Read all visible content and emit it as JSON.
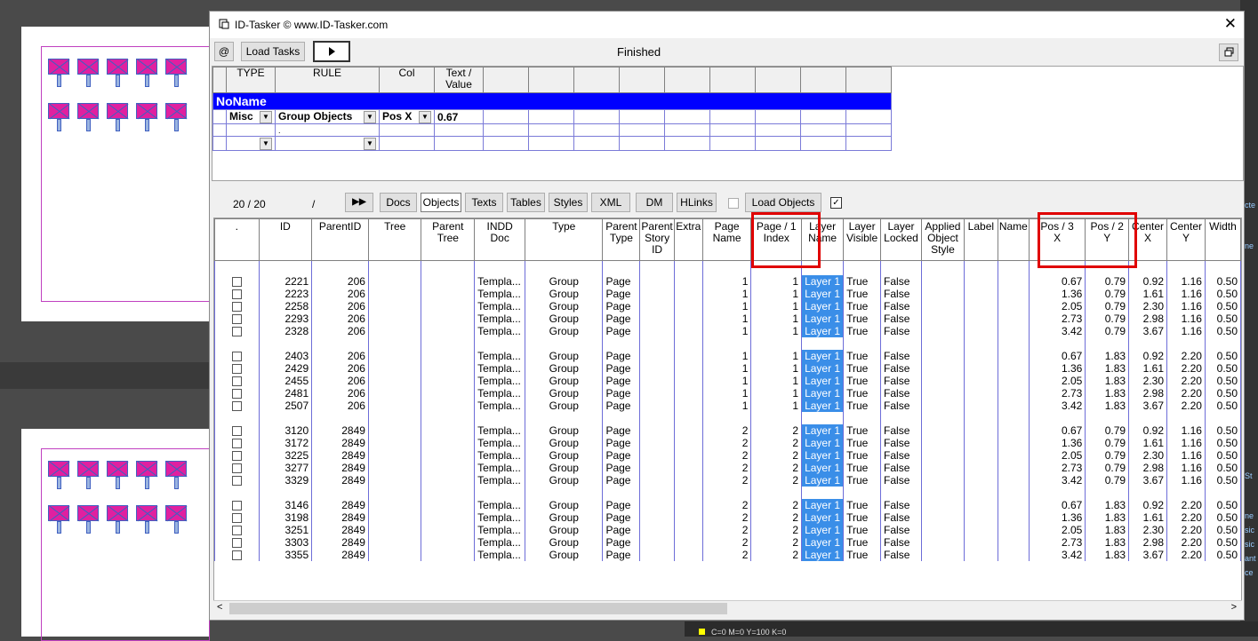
{
  "window": {
    "title": "ID-Tasker  © www.ID-Tasker.com",
    "close_icon": "✕"
  },
  "toolbar": {
    "at_label": "@",
    "load_tasks_label": "Load Tasks",
    "run_icon": "play-icon",
    "status": "Finished",
    "restore_icon": "restore-icon"
  },
  "rules": {
    "headers": [
      "TYPE",
      "RULE",
      "Col",
      "Text / Value"
    ],
    "group_name": "NoName",
    "row": {
      "type": "Misc",
      "rule": "Group Objects",
      "col": "Pos X",
      "value": "0.67"
    },
    "sub_row_mark": "."
  },
  "nav": {
    "counter": "20 / 20",
    "slash": "/",
    "forward_icon": "▶▶",
    "tabs": [
      "Docs",
      "Objects",
      "Texts",
      "Tables",
      "Styles",
      "XML",
      "DM",
      "HLinks"
    ],
    "selected_tab": "Objects",
    "load_objects_label": "Load Objects"
  },
  "grid": {
    "columns": [
      {
        "h1": ".",
        "h2": ""
      },
      {
        "h1": "ID",
        "h2": ""
      },
      {
        "h1": "ParentID",
        "h2": ""
      },
      {
        "h1": "Tree",
        "h2": ""
      },
      {
        "h1": "Parent",
        "h2": "Tree"
      },
      {
        "h1": "INDD",
        "h2": "Doc"
      },
      {
        "h1": "Type",
        "h2": ""
      },
      {
        "h1": "Parent",
        "h2": "Type"
      },
      {
        "h1": "Parent",
        "h2": "Story ID"
      },
      {
        "h1": "Extra",
        "h2": ""
      },
      {
        "h1": "Page",
        "h2": "Name"
      },
      {
        "h1": "Page / 1",
        "h2": "Index"
      },
      {
        "h1": "Layer",
        "h2": "Name"
      },
      {
        "h1": "Layer",
        "h2": "Visible"
      },
      {
        "h1": "Layer",
        "h2": "Locked"
      },
      {
        "h1": "Applied",
        "h2": "Object Style"
      },
      {
        "h1": "Label",
        "h2": ""
      },
      {
        "h1": "Name",
        "h2": ""
      },
      {
        "h1": "Pos / 3",
        "h2": "X"
      },
      {
        "h1": "Pos / 2",
        "h2": "Y"
      },
      {
        "h1": "Center",
        "h2": "X"
      },
      {
        "h1": "Center",
        "h2": "Y"
      },
      {
        "h1": "Width",
        "h2": ""
      }
    ],
    "groups": [
      [
        {
          "id": "2221",
          "parent": "206",
          "doc": "Templa...",
          "type": "Group",
          "ptype": "Page",
          "pname": "1",
          "pindex": "1",
          "layer": "Layer 1",
          "vis": "True",
          "lock": "False",
          "px": "0.67",
          "py": "0.79",
          "cx": "0.92",
          "cy": "1.16",
          "w": "0.50"
        },
        {
          "id": "2223",
          "parent": "206",
          "doc": "Templa...",
          "type": "Group",
          "ptype": "Page",
          "pname": "1",
          "pindex": "1",
          "layer": "Layer 1",
          "vis": "True",
          "lock": "False",
          "px": "1.36",
          "py": "0.79",
          "cx": "1.61",
          "cy": "1.16",
          "w": "0.50"
        },
        {
          "id": "2258",
          "parent": "206",
          "doc": "Templa...",
          "type": "Group",
          "ptype": "Page",
          "pname": "1",
          "pindex": "1",
          "layer": "Layer 1",
          "vis": "True",
          "lock": "False",
          "px": "2.05",
          "py": "0.79",
          "cx": "2.30",
          "cy": "1.16",
          "w": "0.50"
        },
        {
          "id": "2293",
          "parent": "206",
          "doc": "Templa...",
          "type": "Group",
          "ptype": "Page",
          "pname": "1",
          "pindex": "1",
          "layer": "Layer 1",
          "vis": "True",
          "lock": "False",
          "px": "2.73",
          "py": "0.79",
          "cx": "2.98",
          "cy": "1.16",
          "w": "0.50"
        },
        {
          "id": "2328",
          "parent": "206",
          "doc": "Templa...",
          "type": "Group",
          "ptype": "Page",
          "pname": "1",
          "pindex": "1",
          "layer": "Layer 1",
          "vis": "True",
          "lock": "False",
          "px": "3.42",
          "py": "0.79",
          "cx": "3.67",
          "cy": "1.16",
          "w": "0.50"
        }
      ],
      [
        {
          "id": "2403",
          "parent": "206",
          "doc": "Templa...",
          "type": "Group",
          "ptype": "Page",
          "pname": "1",
          "pindex": "1",
          "layer": "Layer 1",
          "vis": "True",
          "lock": "False",
          "px": "0.67",
          "py": "1.83",
          "cx": "0.92",
          "cy": "2.20",
          "w": "0.50"
        },
        {
          "id": "2429",
          "parent": "206",
          "doc": "Templa...",
          "type": "Group",
          "ptype": "Page",
          "pname": "1",
          "pindex": "1",
          "layer": "Layer 1",
          "vis": "True",
          "lock": "False",
          "px": "1.36",
          "py": "1.83",
          "cx": "1.61",
          "cy": "2.20",
          "w": "0.50"
        },
        {
          "id": "2455",
          "parent": "206",
          "doc": "Templa...",
          "type": "Group",
          "ptype": "Page",
          "pname": "1",
          "pindex": "1",
          "layer": "Layer 1",
          "vis": "True",
          "lock": "False",
          "px": "2.05",
          "py": "1.83",
          "cx": "2.30",
          "cy": "2.20",
          "w": "0.50"
        },
        {
          "id": "2481",
          "parent": "206",
          "doc": "Templa...",
          "type": "Group",
          "ptype": "Page",
          "pname": "1",
          "pindex": "1",
          "layer": "Layer 1",
          "vis": "True",
          "lock": "False",
          "px": "2.73",
          "py": "1.83",
          "cx": "2.98",
          "cy": "2.20",
          "w": "0.50"
        },
        {
          "id": "2507",
          "parent": "206",
          "doc": "Templa...",
          "type": "Group",
          "ptype": "Page",
          "pname": "1",
          "pindex": "1",
          "layer": "Layer 1",
          "vis": "True",
          "lock": "False",
          "px": "3.42",
          "py": "1.83",
          "cx": "3.67",
          "cy": "2.20",
          "w": "0.50"
        }
      ],
      [
        {
          "id": "3120",
          "parent": "2849",
          "doc": "Templa...",
          "type": "Group",
          "ptype": "Page",
          "pname": "2",
          "pindex": "2",
          "layer": "Layer 1",
          "vis": "True",
          "lock": "False",
          "px": "0.67",
          "py": "0.79",
          "cx": "0.92",
          "cy": "1.16",
          "w": "0.50"
        },
        {
          "id": "3172",
          "parent": "2849",
          "doc": "Templa...",
          "type": "Group",
          "ptype": "Page",
          "pname": "2",
          "pindex": "2",
          "layer": "Layer 1",
          "vis": "True",
          "lock": "False",
          "px": "1.36",
          "py": "0.79",
          "cx": "1.61",
          "cy": "1.16",
          "w": "0.50"
        },
        {
          "id": "3225",
          "parent": "2849",
          "doc": "Templa...",
          "type": "Group",
          "ptype": "Page",
          "pname": "2",
          "pindex": "2",
          "layer": "Layer 1",
          "vis": "True",
          "lock": "False",
          "px": "2.05",
          "py": "0.79",
          "cx": "2.30",
          "cy": "1.16",
          "w": "0.50"
        },
        {
          "id": "3277",
          "parent": "2849",
          "doc": "Templa...",
          "type": "Group",
          "ptype": "Page",
          "pname": "2",
          "pindex": "2",
          "layer": "Layer 1",
          "vis": "True",
          "lock": "False",
          "px": "2.73",
          "py": "0.79",
          "cx": "2.98",
          "cy": "1.16",
          "w": "0.50"
        },
        {
          "id": "3329",
          "parent": "2849",
          "doc": "Templa...",
          "type": "Group",
          "ptype": "Page",
          "pname": "2",
          "pindex": "2",
          "layer": "Layer 1",
          "vis": "True",
          "lock": "False",
          "px": "3.42",
          "py": "0.79",
          "cx": "3.67",
          "cy": "1.16",
          "w": "0.50"
        }
      ],
      [
        {
          "id": "3146",
          "parent": "2849",
          "doc": "Templa...",
          "type": "Group",
          "ptype": "Page",
          "pname": "2",
          "pindex": "2",
          "layer": "Layer 1",
          "vis": "True",
          "lock": "False",
          "px": "0.67",
          "py": "1.83",
          "cx": "0.92",
          "cy": "2.20",
          "w": "0.50"
        },
        {
          "id": "3198",
          "parent": "2849",
          "doc": "Templa...",
          "type": "Group",
          "ptype": "Page",
          "pname": "2",
          "pindex": "2",
          "layer": "Layer 1",
          "vis": "True",
          "lock": "False",
          "px": "1.36",
          "py": "1.83",
          "cx": "1.61",
          "cy": "2.20",
          "w": "0.50"
        },
        {
          "id": "3251",
          "parent": "2849",
          "doc": "Templa...",
          "type": "Group",
          "ptype": "Page",
          "pname": "2",
          "pindex": "2",
          "layer": "Layer 1",
          "vis": "True",
          "lock": "False",
          "px": "2.05",
          "py": "1.83",
          "cx": "2.30",
          "cy": "2.20",
          "w": "0.50"
        },
        {
          "id": "3303",
          "parent": "2849",
          "doc": "Templa...",
          "type": "Group",
          "ptype": "Page",
          "pname": "2",
          "pindex": "2",
          "layer": "Layer 1",
          "vis": "True",
          "lock": "False",
          "px": "2.73",
          "py": "1.83",
          "cx": "2.98",
          "cy": "2.20",
          "w": "0.50"
        },
        {
          "id": "3355",
          "parent": "2849",
          "doc": "Templa...",
          "type": "Group",
          "ptype": "Page",
          "pname": "2",
          "pindex": "2",
          "layer": "Layer 1",
          "vis": "True",
          "lock": "False",
          "px": "3.42",
          "py": "1.83",
          "cx": "3.67",
          "cy": "2.20",
          "w": "0.50"
        }
      ]
    ],
    "scroll_left": "<",
    "scroll_right": ">"
  },
  "background": {
    "right_panel_snippets": [
      "cte",
      "ne",
      "St",
      "ne",
      "sic",
      "sic",
      "ant",
      "ce"
    ],
    "swatch_label": "C=0 M=0 Y=100 K=0"
  },
  "colors": {
    "noname_bar": "#0000ff",
    "layer_cell": "#3a8ee8",
    "highlight_box": "#e00000",
    "grid_line": "#6d6dd8"
  }
}
